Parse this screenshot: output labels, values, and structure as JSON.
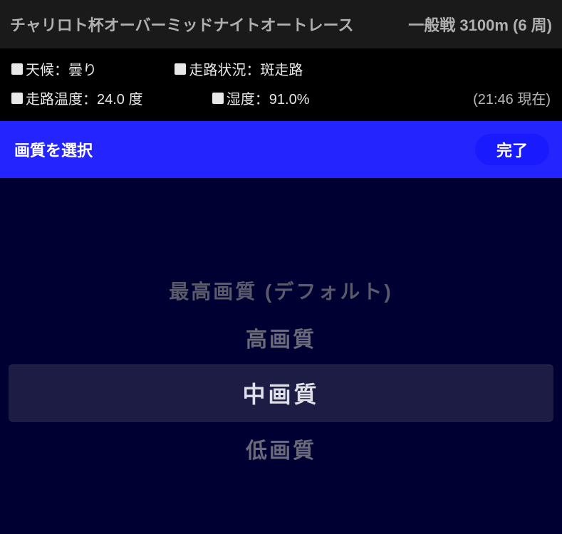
{
  "header": {
    "race_title": "チャリロト杯オーバーミッドナイトオートレース",
    "race_info": "一般戦 3100m (6 周)"
  },
  "conditions": {
    "weather_label": "天候：曇り",
    "track_label": "走路状況：斑走路",
    "track_temp_label": "走路温度：24.0 度",
    "humidity_label": "湿度：91.0%",
    "timestamp": "(21:46 現在)"
  },
  "modal": {
    "title": "画質を選択",
    "done_label": "完了"
  },
  "picker": {
    "options": [
      "最高画質 (デフォルト)",
      "高画質",
      "中画質",
      "低画質"
    ],
    "selected_index": 2
  }
}
